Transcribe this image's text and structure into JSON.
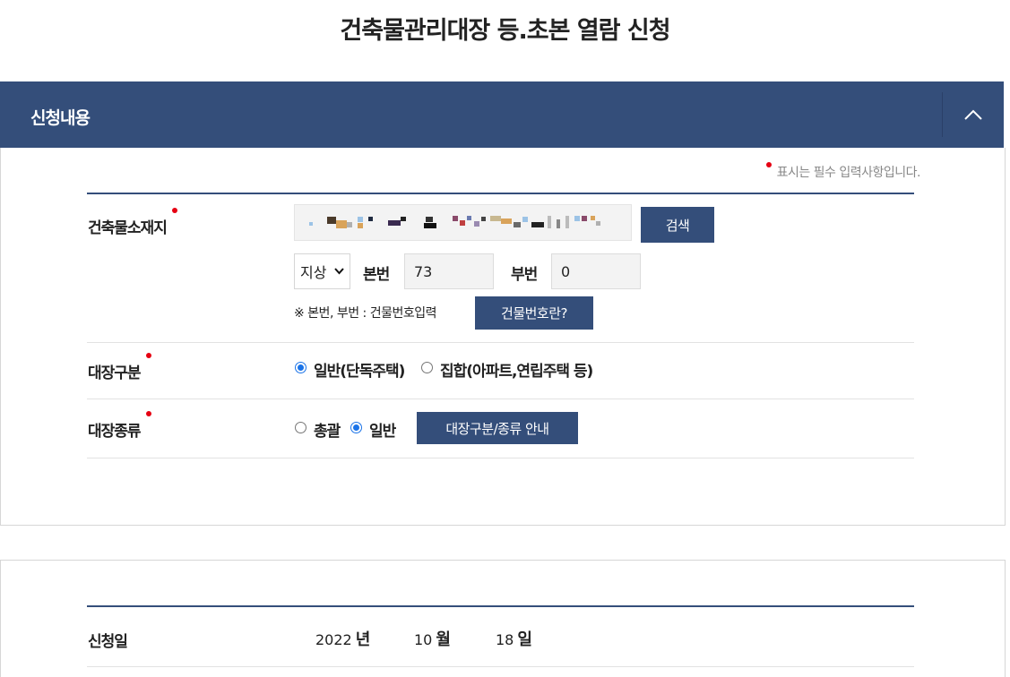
{
  "page": {
    "title": "건축물관리대장 등.초본 열람 신청"
  },
  "section": {
    "title": "신청내용"
  },
  "required_note": "표시는 필수 입력사항입니다.",
  "building_location": {
    "label": "건축물소재지",
    "search_button": "검색",
    "land_type": "지상",
    "main_number_label": "본번",
    "main_number_value": "73",
    "sub_number_label": "부번",
    "sub_number_value": "0",
    "hint": "※ 본번, 부번 : 건물번호입력",
    "help_button": "건물번호란?"
  },
  "register_type": {
    "label": "대장구분",
    "options": [
      {
        "label": "일반(단독주택)",
        "checked": true
      },
      {
        "label": "집합(아파트,연립주택 등)",
        "checked": false
      }
    ]
  },
  "register_kind": {
    "label": "대장종류",
    "options": [
      {
        "label": "총괄",
        "checked": false
      },
      {
        "label": "일반",
        "checked": true
      }
    ],
    "guide_button": "대장구분/종류 안내"
  },
  "application_date": {
    "label": "신청일",
    "year": "2022",
    "year_unit": "년",
    "month": "10",
    "month_unit": "월",
    "day": "18",
    "day_unit": "일"
  },
  "colors": {
    "primary": "#344e7a",
    "required": "#e60012",
    "radio_checked": "#1a73e8"
  }
}
